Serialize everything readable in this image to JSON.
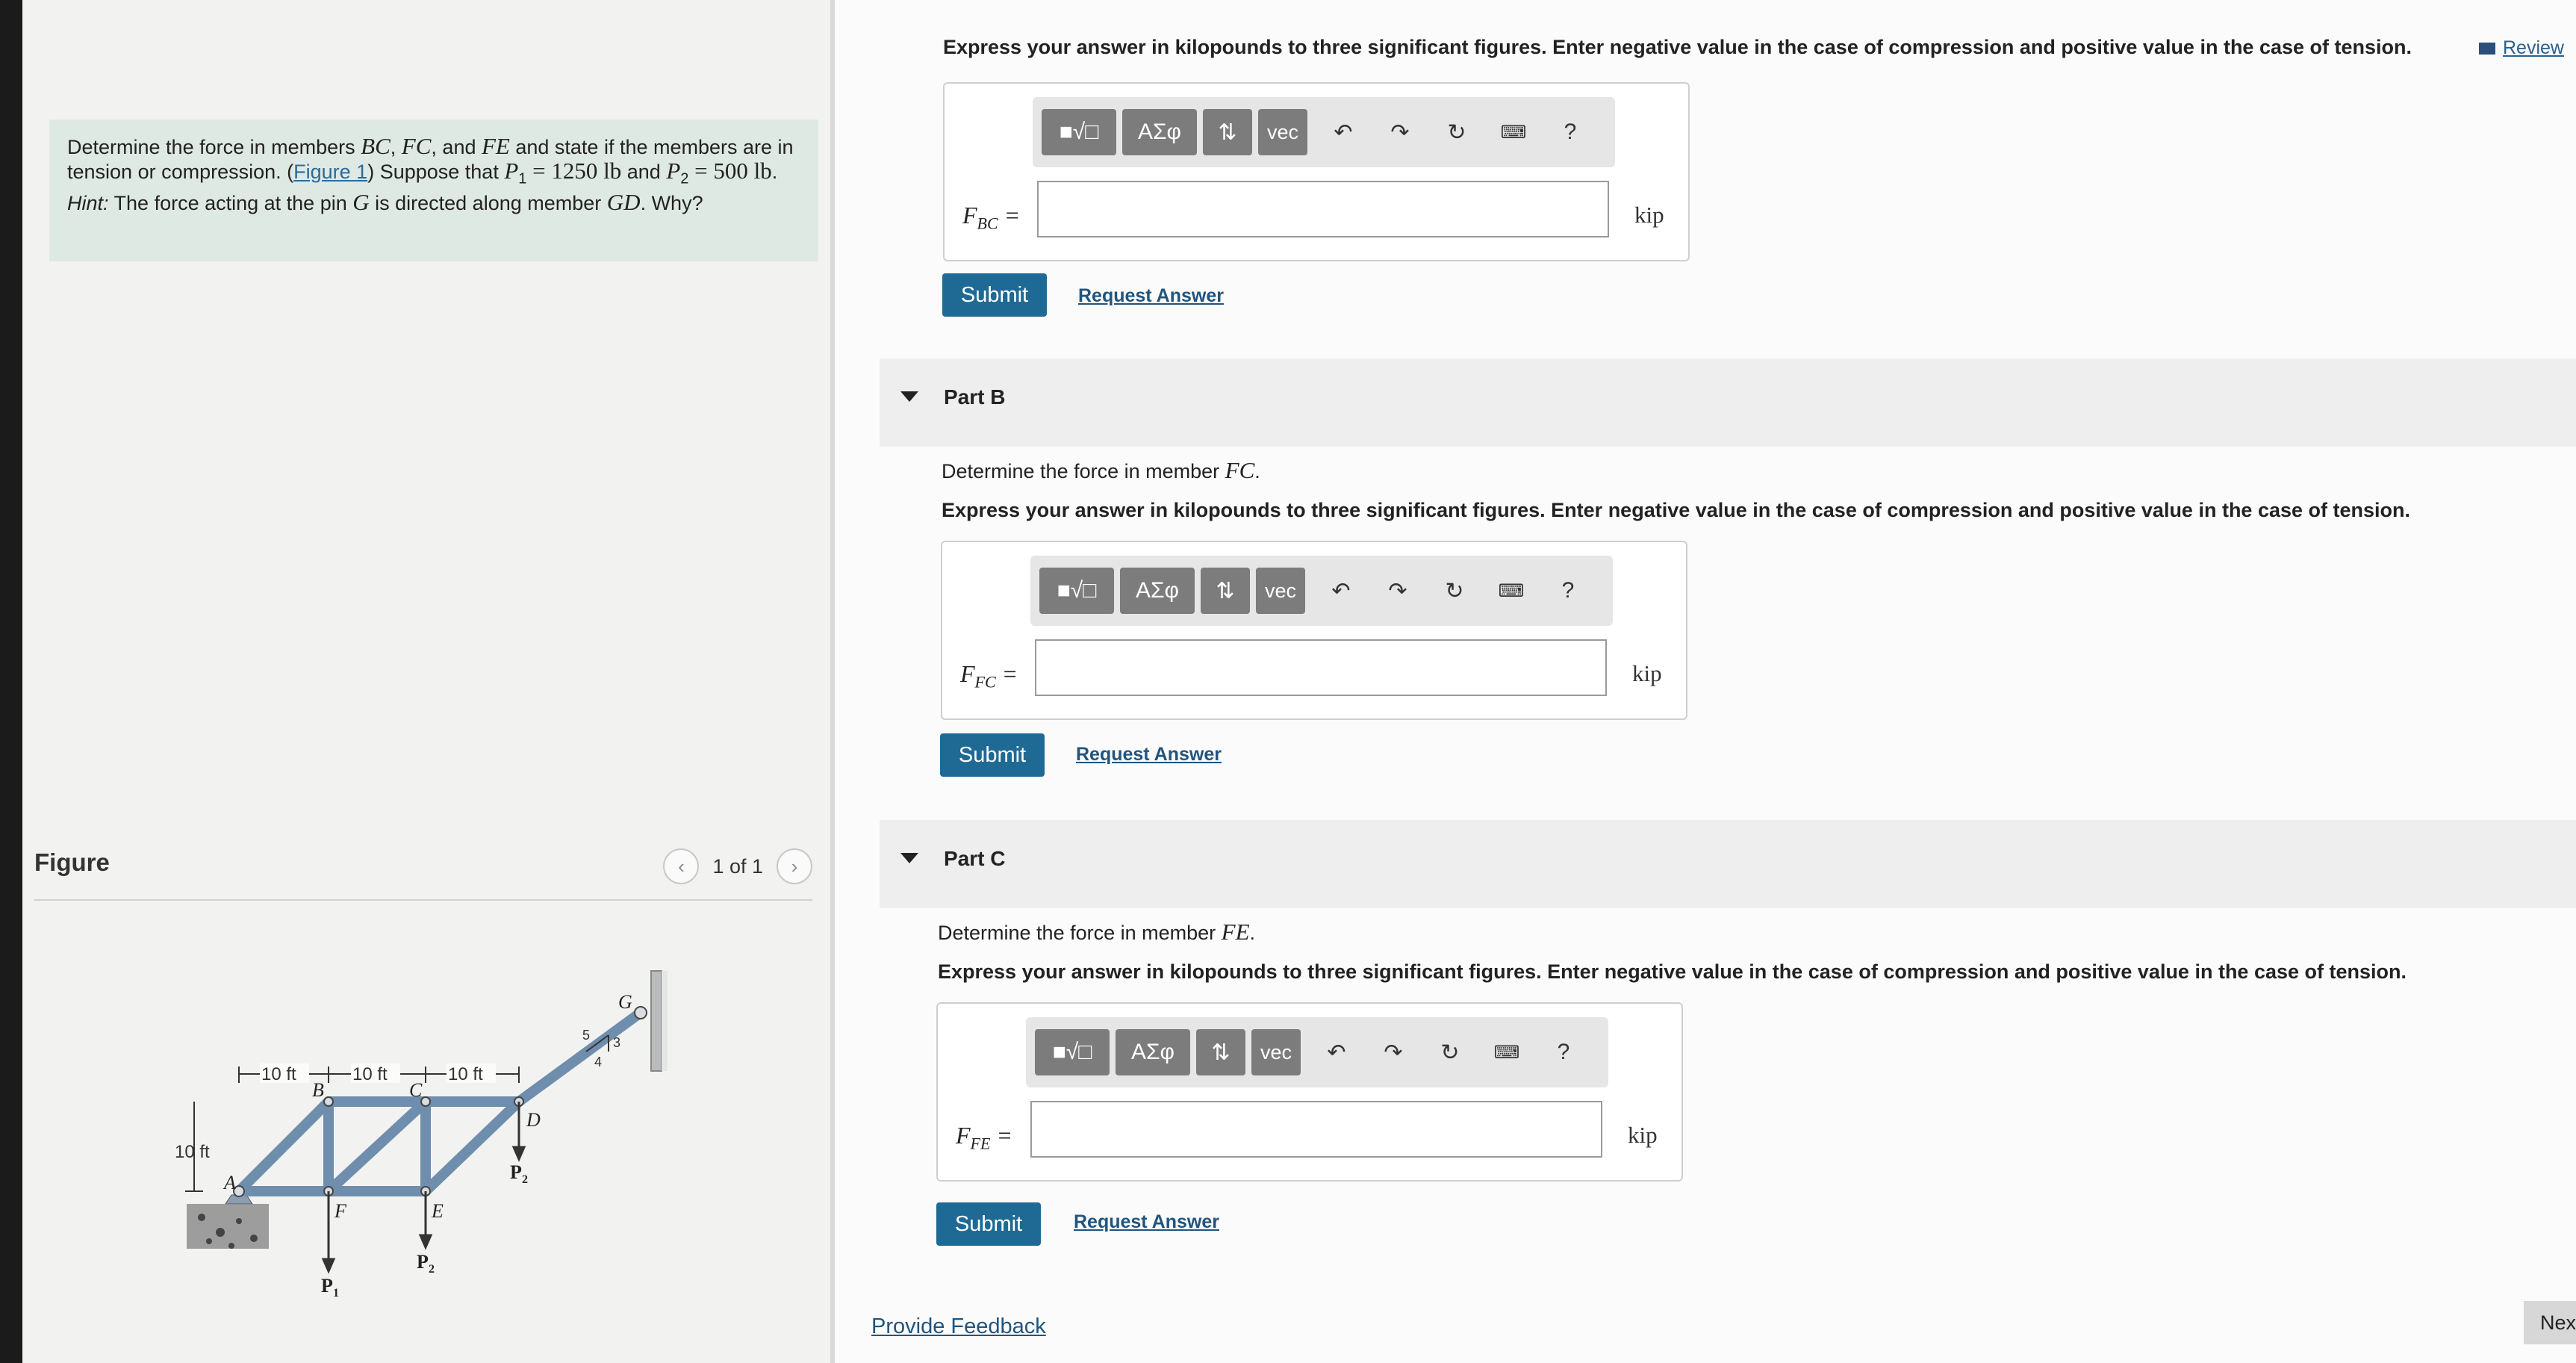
{
  "problem": {
    "text1": "Determine the force in members ",
    "bc": "BC",
    "sep1": ", ",
    "fc": "FC",
    "sep2": ", and ",
    "fe": "FE",
    "text2": " and state if the members are in tension or compression. (",
    "figure_link": "Figure 1",
    "text3": ") Suppose that ",
    "p1_sym": "P",
    "p1_sub": "1",
    "p1_val": " = 1250 lb",
    "text4": " and ",
    "p2_sym": "P",
    "p2_sub": "2",
    "p2_val": " = 500 lb",
    "text5": ". ",
    "hint_label": "Hint:",
    "text6": " The force acting at the pin ",
    "g": "G",
    "text7": " is directed along member ",
    "gd": "GD",
    "text8": ". Why?"
  },
  "figure": {
    "title": "Figure",
    "pager": "1 of 1",
    "labels": {
      "dim1": "10 ft",
      "dim2": "10 ft",
      "dim3": "10 ft",
      "height": "10 ft",
      "A": "A",
      "B": "B",
      "C": "C",
      "D": "D",
      "E": "E",
      "F": "F",
      "G": "G",
      "P1": "P",
      "P1_sub": "1",
      "P2a": "P",
      "P2a_sub": "2",
      "P2b": "P",
      "P2b_sub": "2",
      "slope_5": "5",
      "slope_3": "3",
      "slope_4": "4"
    }
  },
  "header": {
    "review": "Review"
  },
  "part_a": {
    "instructions": "Express your answer in kilopounds to three significant figures. Enter negative value in the case of compression and positive value in the case of tension.",
    "var_main": "F",
    "var_sub": "BC",
    "unit": "kip",
    "input_value": "",
    "submit": "Submit",
    "request": "Request Answer"
  },
  "part_b": {
    "title": "Part B",
    "question_prefix": "Determine the force in member ",
    "question_member": "FC",
    "question_suffix": ".",
    "instructions": "Express your answer in kilopounds to three significant figures. Enter negative value in the case of compression and positive value in the case of tension.",
    "var_main": "F",
    "var_sub": "FC",
    "unit": "kip",
    "input_value": "",
    "submit": "Submit",
    "request": "Request Answer"
  },
  "part_c": {
    "title": "Part C",
    "question_prefix": "Determine the force in member ",
    "question_member": "FE",
    "question_suffix": ".",
    "instructions": "Express your answer in kilopounds to three significant figures. Enter negative value in the case of compression and positive value in the case of tension.",
    "var_main": "F",
    "var_sub": "FE",
    "unit": "kip",
    "input_value": "",
    "submit": "Submit",
    "request": "Request Answer"
  },
  "toolbar": {
    "templates_icon": "fraction-sqrt-template-icon",
    "greek": "ΑΣφ",
    "arrows": "⇅",
    "vec": "vec",
    "undo_icon": "undo-icon",
    "redo_icon": "redo-icon",
    "reset_icon": "reset-icon",
    "keyboard_icon": "keyboard-icon",
    "help": "?"
  },
  "footer": {
    "feedback": "Provide Feedback",
    "next": "Nex"
  }
}
